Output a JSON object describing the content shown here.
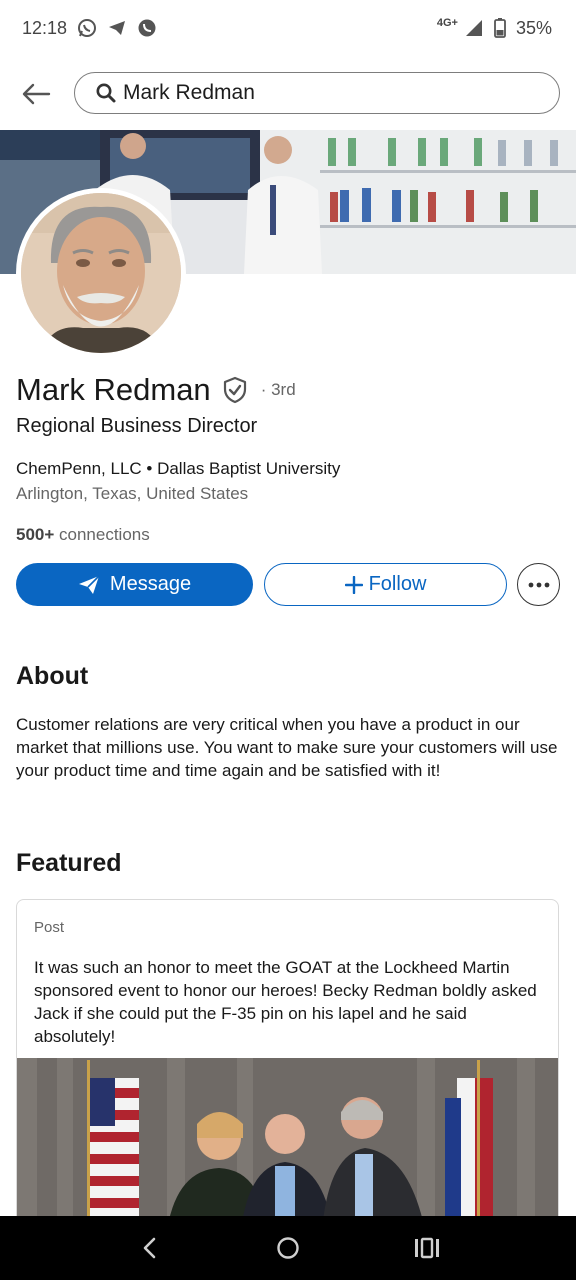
{
  "status_bar": {
    "time": "12:18",
    "network": "4G+",
    "battery": "35%",
    "notification_icons": [
      "whatsapp-icon",
      "telegram-icon",
      "viber-icon"
    ]
  },
  "search": {
    "query": "Mark Redman"
  },
  "profile": {
    "name": "Mark Redman",
    "degree": "· 3rd",
    "headline": "Regional Business Director",
    "company_education": "ChemPenn, LLC • Dallas Baptist University",
    "location": "Arlington, Texas, United States",
    "connections_count": "500+",
    "connections_label": " connections"
  },
  "actions": {
    "message_label": "Message",
    "follow_label": "Follow"
  },
  "about": {
    "title": "About",
    "text": "Customer relations are very critical when you have a product in our market that millions use. You want to make sure your customers will use your product time and time again and be satisfied with it!"
  },
  "featured": {
    "title": "Featured",
    "items": [
      {
        "type": "Post",
        "text": "It was such an honor to meet the GOAT at the Lockheed Martin sponsored event to honor our heroes! Becky Redman boldly asked Jack if she could put the F-35 pin on his lapel and he said absolutely!"
      }
    ]
  },
  "colors": {
    "primary": "#0a66c2",
    "text": "#191919",
    "muted": "#666666"
  }
}
